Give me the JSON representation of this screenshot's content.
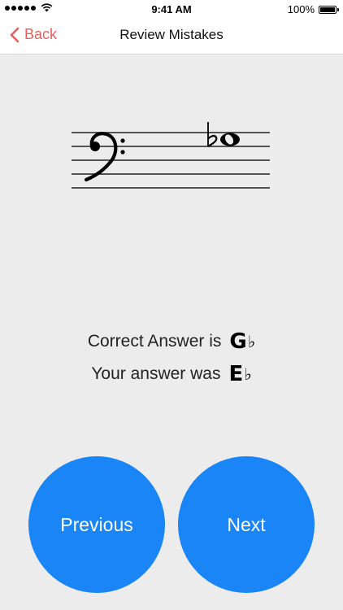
{
  "status_bar": {
    "time": "9:41 AM",
    "battery": "100%"
  },
  "nav": {
    "back_label": "Back",
    "title": "Review Mistakes"
  },
  "answers": {
    "correct_label": "Correct Answer is",
    "correct_note": "G",
    "correct_accidental": "♭",
    "yours_label": "Your answer was",
    "yours_note": "E",
    "yours_accidental": "♭"
  },
  "buttons": {
    "previous_label": "Previous",
    "next_label": "Next"
  },
  "colors": {
    "accent_back": "#e5605d",
    "button_blue": "#1a85f7",
    "background": "#ececec"
  }
}
